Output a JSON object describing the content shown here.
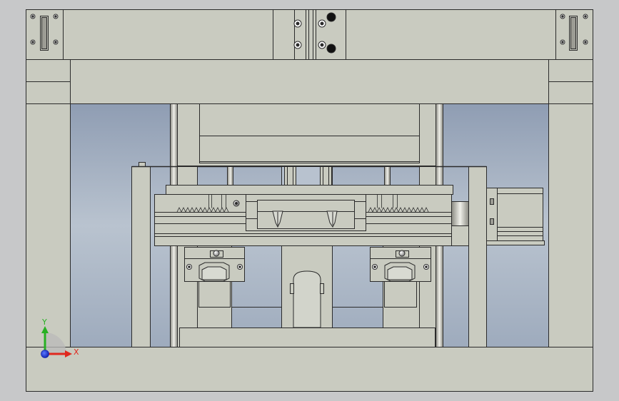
{
  "viewport": {
    "background": "#c7c8c9",
    "colors": {
      "part_fill": "#c9cbc0",
      "part_stroke": "#2b2b2b",
      "cavity_fill": "#a4afbf",
      "cavity_light": "#b8c2cf",
      "hole_dark": "#111111"
    }
  },
  "triad": {
    "x_label": "X",
    "y_label": "Y",
    "x_color": "#e0281e",
    "y_color": "#27b023",
    "z_color": "#1d3ce0"
  }
}
